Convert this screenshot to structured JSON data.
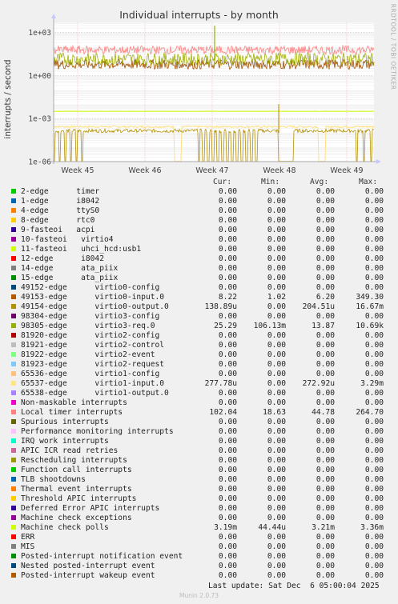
{
  "title": "Individual interrupts - by month",
  "ylabel": "interrupts / second",
  "watermark": "RRDTOOL / TOBI OETIKER",
  "footer": "Munin 2.0.73",
  "last_update": "Last update: Sat Dec  6 05:00:04 2025",
  "columns": [
    "Cur:",
    "Min:",
    "Avg:",
    "Max:"
  ],
  "chart_data": {
    "type": "line",
    "title": "Individual interrupts - by month",
    "ylabel": "interrupts / second",
    "yscale": "log",
    "ylim": [
      1e-06,
      5000
    ],
    "yticks": [
      "1e-06",
      "1e-03",
      "1e+00",
      "1e+03"
    ],
    "xticks": [
      "Week 45",
      "Week 46",
      "Week 47",
      "Week 48",
      "Week 49"
    ],
    "grid": true,
    "series": [
      {
        "name": "Local timer interrupts",
        "color": "#ff8080",
        "level": 60
      },
      {
        "name": "49154-edge virtio0-output.0",
        "color": "#f0c000",
        "level": 0.00014
      },
      {
        "name": "98305-edge virtio3-req.0",
        "color": "#a0b000",
        "level": 14
      },
      {
        "name": "49153-edge virtio0-input.0",
        "color": "#a05000",
        "level": 6
      },
      {
        "name": "Machine check polls",
        "color": "#ccff00",
        "level": 0.0032
      },
      {
        "name": "65537-edge virtio1-input.0",
        "color": "#ffe080",
        "level": 0.00027
      }
    ]
  },
  "rows": [
    {
      "label": "2-edge      timer",
      "color": "#00cc00",
      "cur": "0.00",
      "min": "0.00",
      "avg": "0.00",
      "max": "0.00"
    },
    {
      "label": "1-edge      i8042",
      "color": "#0066b3",
      "cur": "0.00",
      "min": "0.00",
      "avg": "0.00",
      "max": "0.00"
    },
    {
      "label": "4-edge      ttyS0",
      "color": "#ff8000",
      "cur": "0.00",
      "min": "0.00",
      "avg": "0.00",
      "max": "0.00"
    },
    {
      "label": "8-edge      rtc0",
      "color": "#ffcc00",
      "cur": "0.00",
      "min": "0.00",
      "avg": "0.00",
      "max": "0.00"
    },
    {
      "label": "9-fasteoi   acpi",
      "color": "#330099",
      "cur": "0.00",
      "min": "0.00",
      "avg": "0.00",
      "max": "0.00"
    },
    {
      "label": "10-fasteoi   virtio4",
      "color": "#990099",
      "cur": "0.00",
      "min": "0.00",
      "avg": "0.00",
      "max": "0.00"
    },
    {
      "label": "11-fasteoi   uhci_hcd:usb1",
      "color": "#ccff00",
      "cur": "0.00",
      "min": "0.00",
      "avg": "0.00",
      "max": "0.00"
    },
    {
      "label": "12-edge      i8042",
      "color": "#ff0000",
      "cur": "0.00",
      "min": "0.00",
      "avg": "0.00",
      "max": "0.00"
    },
    {
      "label": "14-edge      ata_piix",
      "color": "#808080",
      "cur": "0.00",
      "min": "0.00",
      "avg": "0.00",
      "max": "0.00"
    },
    {
      "label": "15-edge      ata_piix",
      "color": "#008f00",
      "cur": "0.00",
      "min": "0.00",
      "avg": "0.00",
      "max": "0.00"
    },
    {
      "label": "49152-edge      virtio0-config",
      "color": "#00487d",
      "cur": "0.00",
      "min": "0.00",
      "avg": "0.00",
      "max": "0.00"
    },
    {
      "label": "49153-edge      virtio0-input.0",
      "color": "#b35a00",
      "cur": "8.22",
      "min": "1.02",
      "avg": "6.20",
      "max": "349.30"
    },
    {
      "label": "49154-edge      virtio0-output.0",
      "color": "#b38f00",
      "cur": "138.89u",
      "min": "0.00",
      "avg": "204.51u",
      "max": "16.67m"
    },
    {
      "label": "98304-edge      virtio3-config",
      "color": "#6b006b",
      "cur": "0.00",
      "min": "0.00",
      "avg": "0.00",
      "max": "0.00"
    },
    {
      "label": "98305-edge      virtio3-req.0",
      "color": "#8fb300",
      "cur": "25.29",
      "min": "106.13m",
      "avg": "13.87",
      "max": "10.69k"
    },
    {
      "label": "81920-edge      virtio2-config",
      "color": "#b30000",
      "cur": "0.00",
      "min": "0.00",
      "avg": "0.00",
      "max": "0.00"
    },
    {
      "label": "81921-edge      virtio2-control",
      "color": "#bebebe",
      "cur": "0.00",
      "min": "0.00",
      "avg": "0.00",
      "max": "0.00"
    },
    {
      "label": "81922-edge      virtio2-event",
      "color": "#80ff80",
      "cur": "0.00",
      "min": "0.00",
      "avg": "0.00",
      "max": "0.00"
    },
    {
      "label": "81923-edge      virtio2-request",
      "color": "#80c9ff",
      "cur": "0.00",
      "min": "0.00",
      "avg": "0.00",
      "max": "0.00"
    },
    {
      "label": "65536-edge      virtio1-config",
      "color": "#ffc080",
      "cur": "0.00",
      "min": "0.00",
      "avg": "0.00",
      "max": "0.00"
    },
    {
      "label": "65537-edge      virtio1-input.0",
      "color": "#ffe680",
      "cur": "277.78u",
      "min": "0.00",
      "avg": "272.92u",
      "max": "3.29m"
    },
    {
      "label": "65538-edge      virtio1-output.0",
      "color": "#aa80ff",
      "cur": "0.00",
      "min": "0.00",
      "avg": "0.00",
      "max": "0.00"
    },
    {
      "label": "Non-maskable interrupts",
      "color": "#ee00cc",
      "cur": "0.00",
      "min": "0.00",
      "avg": "0.00",
      "max": "0.00"
    },
    {
      "label": "Local timer interrupts",
      "color": "#ff8080",
      "cur": "102.04",
      "min": "18.63",
      "avg": "44.78",
      "max": "264.70"
    },
    {
      "label": "Spurious interrupts",
      "color": "#666600",
      "cur": "0.00",
      "min": "0.00",
      "avg": "0.00",
      "max": "0.00"
    },
    {
      "label": "Performance monitoring interrupts",
      "color": "#ffbfff",
      "cur": "0.00",
      "min": "0.00",
      "avg": "0.00",
      "max": "0.00"
    },
    {
      "label": "IRQ work interrupts",
      "color": "#00ffcc",
      "cur": "0.00",
      "min": "0.00",
      "avg": "0.00",
      "max": "0.00"
    },
    {
      "label": "APIC ICR read retries",
      "color": "#cc6699",
      "cur": "0.00",
      "min": "0.00",
      "avg": "0.00",
      "max": "0.00"
    },
    {
      "label": "Rescheduling interrupts",
      "color": "#999900",
      "cur": "0.00",
      "min": "0.00",
      "avg": "0.00",
      "max": "0.00"
    },
    {
      "label": "Function call interrupts",
      "color": "#00cc00",
      "cur": "0.00",
      "min": "0.00",
      "avg": "0.00",
      "max": "0.00"
    },
    {
      "label": "TLB shootdowns",
      "color": "#0066b3",
      "cur": "0.00",
      "min": "0.00",
      "avg": "0.00",
      "max": "0.00"
    },
    {
      "label": "Thermal event interrupts",
      "color": "#ff8000",
      "cur": "0.00",
      "min": "0.00",
      "avg": "0.00",
      "max": "0.00"
    },
    {
      "label": "Threshold APIC interrupts",
      "color": "#ffcc00",
      "cur": "0.00",
      "min": "0.00",
      "avg": "0.00",
      "max": "0.00"
    },
    {
      "label": "Deferred Error APIC interrupts",
      "color": "#330099",
      "cur": "0.00",
      "min": "0.00",
      "avg": "0.00",
      "max": "0.00"
    },
    {
      "label": "Machine check exceptions",
      "color": "#990099",
      "cur": "0.00",
      "min": "0.00",
      "avg": "0.00",
      "max": "0.00"
    },
    {
      "label": "Machine check polls",
      "color": "#ccff00",
      "cur": "3.19m",
      "min": "44.44u",
      "avg": "3.21m",
      "max": "3.36m"
    },
    {
      "label": "ERR",
      "color": "#ff0000",
      "cur": "0.00",
      "min": "0.00",
      "avg": "0.00",
      "max": "0.00"
    },
    {
      "label": "MIS",
      "color": "#808080",
      "cur": "0.00",
      "min": "0.00",
      "avg": "0.00",
      "max": "0.00"
    },
    {
      "label": "Posted-interrupt notification event",
      "color": "#008f00",
      "cur": "0.00",
      "min": "0.00",
      "avg": "0.00",
      "max": "0.00"
    },
    {
      "label": "Nested posted-interrupt event",
      "color": "#00487d",
      "cur": "0.00",
      "min": "0.00",
      "avg": "0.00",
      "max": "0.00"
    },
    {
      "label": "Posted-interrupt wakeup event",
      "color": "#b35a00",
      "cur": "0.00",
      "min": "0.00",
      "avg": "0.00",
      "max": "0.00"
    }
  ]
}
